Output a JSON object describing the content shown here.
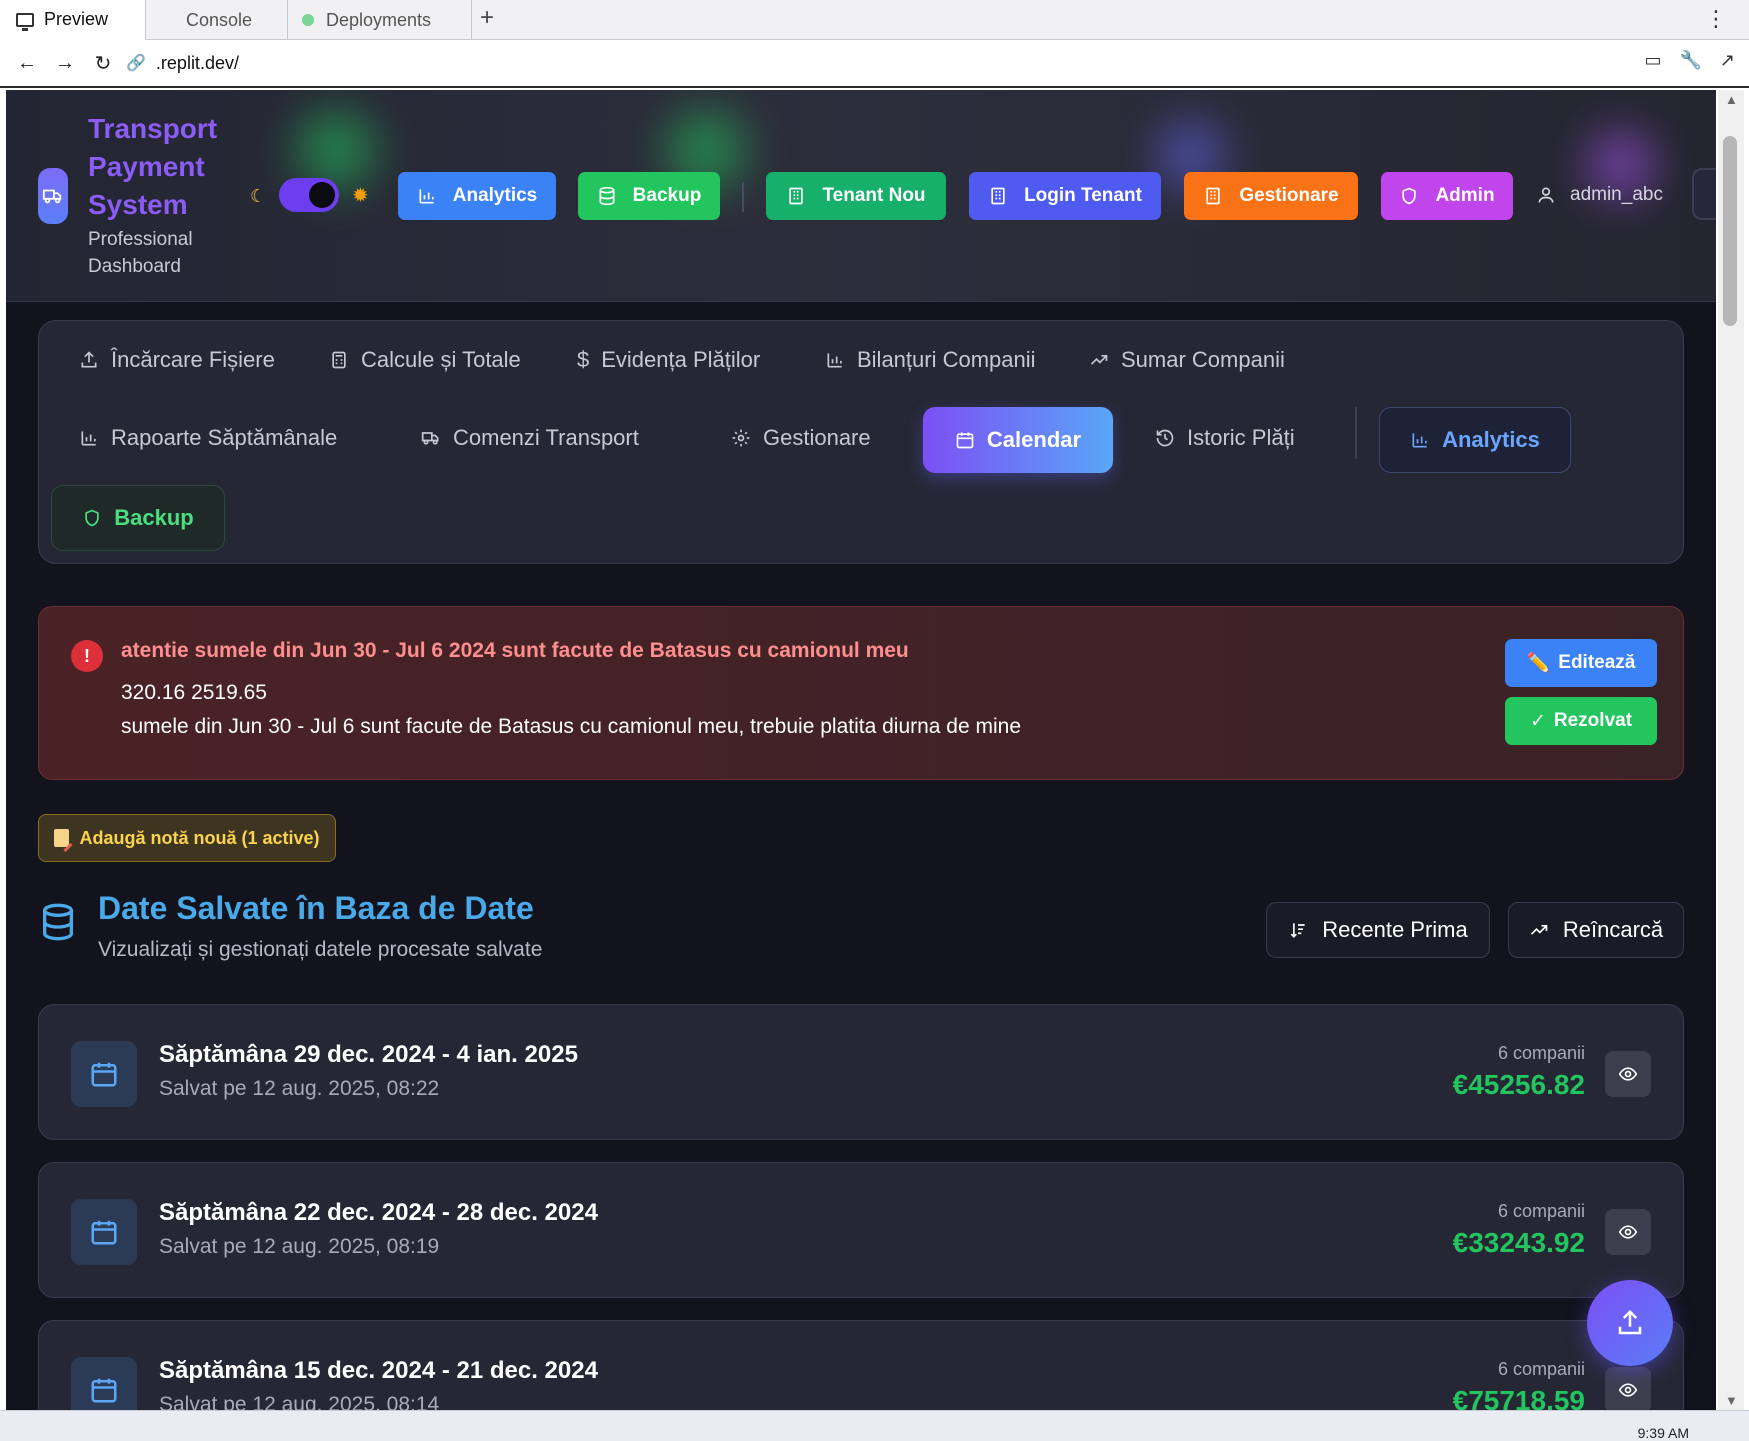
{
  "browser": {
    "tabs": [
      "Preview",
      "Console",
      "Deployments"
    ],
    "new_tab": "+",
    "url": ".replit.dev/"
  },
  "header": {
    "brand_title": "Transport Payment System",
    "brand_subtitle": "Professional Dashboard",
    "buttons": [
      {
        "label": "Analytics",
        "color": "#3b82f6",
        "icon": "bar-chart-icon"
      },
      {
        "label": "Backup",
        "color": "#22c55e",
        "icon": "database-icon"
      },
      {
        "label": "Tenant Nou",
        "color": "#16b06a",
        "icon": "building-icon"
      },
      {
        "label": "Login Tenant",
        "color": "#4f5bf0",
        "icon": "building-icon"
      },
      {
        "label": "Gestionare",
        "color": "#f97316",
        "icon": "building-icon"
      },
      {
        "label": "Admin",
        "color": "#c145ec",
        "icon": "shield-icon"
      }
    ],
    "username": "admin_abc",
    "theme_dark": true
  },
  "nav": {
    "items": [
      {
        "label": "Încărcare Fișiere",
        "icon": "upload-icon"
      },
      {
        "label": "Calcule și Totale",
        "icon": "calculator-icon"
      },
      {
        "label": "Evidența Plăților",
        "icon": "dollar-icon"
      },
      {
        "label": "Bilanțuri Companii",
        "icon": "bar-chart-icon"
      },
      {
        "label": "Sumar Companii",
        "icon": "trending-up-icon"
      },
      {
        "label": "Rapoarte Săptămânale",
        "icon": "bar-chart-icon"
      },
      {
        "label": "Comenzi Transport",
        "icon": "truck-icon"
      },
      {
        "label": "Gestionare",
        "icon": "gear-icon"
      },
      {
        "label": "Calendar",
        "icon": "calendar-icon",
        "active": true
      },
      {
        "label": "Istoric Plăți",
        "icon": "history-icon"
      },
      {
        "label": "Analytics",
        "icon": "bar-chart-icon"
      },
      {
        "label": "Backup",
        "icon": "shield-icon"
      }
    ]
  },
  "alert": {
    "title": "atentie sumele din Jun 30 - Jul 6 2024 sunt facute de Batasus cu camionul meu",
    "line1": "320.16 2519.65",
    "line2": "sumele din Jun 30 - Jul 6 sunt facute de Batasus cu camionul meu, trebuie platita diurna de mine",
    "edit_label": "Editează",
    "resolve_label": "Rezolvat",
    "edit_emoji": "✏️",
    "resolve_glyph": "✓"
  },
  "note_button": "Adaugă notă nouă (1 active)",
  "section": {
    "title": "Date Salvate în Baza de Date",
    "subtitle": "Vizualizați și gestionați datele procesate salvate",
    "sort_label": "Recente Prima",
    "reload_label": "Reîncarcă"
  },
  "weeks": [
    {
      "title": "Săptămâna 29 dec. 2024 - 4 ian. 2025",
      "saved": "Salvat pe 12 aug. 2025, 08:22",
      "companies": "6 companii",
      "total": "€45256.82"
    },
    {
      "title": "Săptămâna 22 dec. 2024 - 28 dec. 2024",
      "saved": "Salvat pe 12 aug. 2025, 08:19",
      "companies": "6 companii",
      "total": "€33243.92"
    },
    {
      "title": "Săptămâna 15 dec. 2024 - 21 dec. 2024",
      "saved": "Salvat pe 12 aug. 2025, 08:14",
      "companies": "6 companii",
      "total": "€75718.59"
    }
  ],
  "taskbar": {
    "clock": "9:39 AM"
  }
}
